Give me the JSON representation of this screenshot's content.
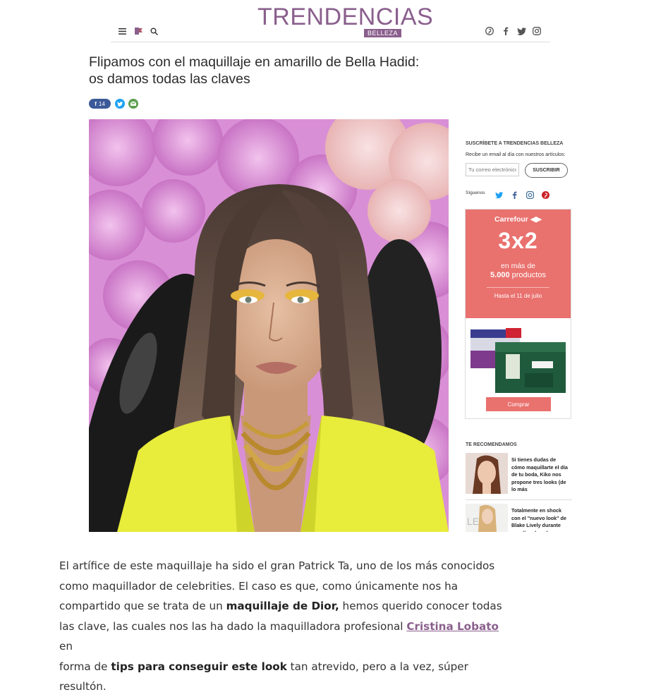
{
  "header": {
    "logo": "TRENDENCIAS",
    "logo_sub": "BELLEZA"
  },
  "article": {
    "title_line1": "Flipamos con el maquillaje en amarillo de Bella Hadid:",
    "title_line2": "os damos todas las claves",
    "facebook_count": "14",
    "body": {
      "p1": "El artífice de este maquillaje ha sido el gran Patrick Ta, uno de los más conocidos",
      "p2": "como maquillador de celebrities. El caso es que, como únicamente nos ha",
      "p3a": "compartido que se trata de un ",
      "p3b": "maquillaje de Dior,",
      "p3c": " hemos querido conocer todas",
      "p4a": "las clave, las cuales nos las ha dado la maquilladora profesional ",
      "p4link": "Cristina Lobato",
      "p4b": " en",
      "p5a": "forma de ",
      "p5b": "tips para conseguir este look",
      "p5c": " tan atrevido, pero a la vez, súper resultón."
    }
  },
  "sidebar": {
    "subscribe_title": "SUSCRÍBETE A TRENDENCIAS BELLEZA",
    "subscribe_desc": "Recibe un email al día con nuestros artículos:",
    "email_placeholder": "Tu correo electrónico",
    "subscribe_button": "SUSCRIBIR",
    "follow_label": "Síguenos",
    "ad": {
      "brand": "Carrefour",
      "offer": "3x2",
      "line1": "en más de",
      "line2_bold": "5.000",
      "line2_rest": " productos",
      "until": "Hasta el 11 de julio",
      "button": "Comprar"
    },
    "recommend_title": "TE RECOMENDAMOS",
    "recommended": [
      {
        "text": "Si tienes dudas de cómo maquillarte el día de tu boda, Kiko nos propone tres looks (de lo más"
      },
      {
        "text": "Totalmente en shock con el \"nuevo look\" de Blake Lively durante sus días de gala ... en"
      }
    ]
  },
  "colors": {
    "brand": "#8a5f8d",
    "ad_red": "#e9716e",
    "facebook": "#3b5998",
    "twitter": "#1da1f2",
    "email": "#5e9e4f",
    "pinterest": "#cb2027"
  }
}
